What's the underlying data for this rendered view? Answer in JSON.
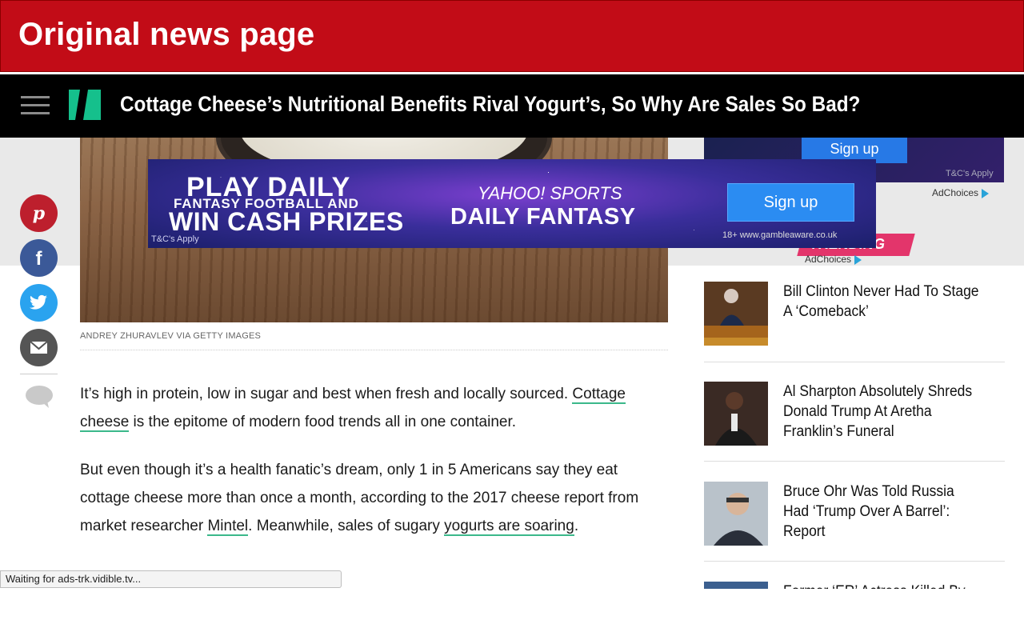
{
  "banner": {
    "title": "Original news page"
  },
  "nav": {
    "headline": "Cottage Cheese’s Nutritional Benefits Rival Yogurt’s, So Why Are Sales So Bad?"
  },
  "colors": {
    "banner_red": "#c20c17",
    "brand_green": "#15c08c",
    "trending_pink": "#e3356b",
    "link_underline": "#3bb88a"
  },
  "article": {
    "photo_credit": "ANDREY ZHURAVLEV VIA GETTY IMAGES",
    "p1": {
      "before": "It’s high in protein, low in sugar and best when fresh and locally sourced. ",
      "link": "Cottage cheese",
      "after": " is the epitome of modern food trends all in one container."
    },
    "p2": {
      "before": "But even though it’s a health fanatic’s dream, only 1 in 5 Americans say they eat cottage cheese more than once a month, according to the 2017 cheese report from market researcher ",
      "link1": "Mintel",
      "middle": ". Meanwhile, sales of sugary ",
      "link2": "yogurts are soaring",
      "after": "."
    }
  },
  "share": {
    "icons": [
      "pinterest-icon",
      "facebook-icon",
      "twitter-icon",
      "email-icon",
      "comment-icon"
    ]
  },
  "ads": {
    "top": {
      "button": "Sign up",
      "tc": "T&C's Apply",
      "adchoices": "AdChoices"
    },
    "main": {
      "line1": "PLAY DAILY",
      "line2": "FANTASY FOOTBALL AND",
      "line3": "WIN CASH PRIZES",
      "tc": "T&C's Apply",
      "brand_line1": "YAHOO! SPORTS",
      "brand_line2": "DAILY FANTASY",
      "button": "Sign up",
      "gamble": "18+ www.gambleaware.co.uk"
    },
    "mid": {
      "adchoices": "AdChoices"
    }
  },
  "trending": {
    "label": "TRENDING",
    "items": [
      {
        "title": "Bill Clinton Never Had To Stage A ‘Comeback’"
      },
      {
        "title": "Al Sharpton Absolutely Shreds Donald Trump At Aretha Franklin’s Funeral"
      },
      {
        "title": "Bruce Ohr Was Told Russia Had ‘Trump Over A Barrel’: Report"
      },
      {
        "title": "Former ‘ER’ Actress Killed By"
      }
    ]
  },
  "status": {
    "text": "Waiting for ads-trk.vidible.tv..."
  }
}
